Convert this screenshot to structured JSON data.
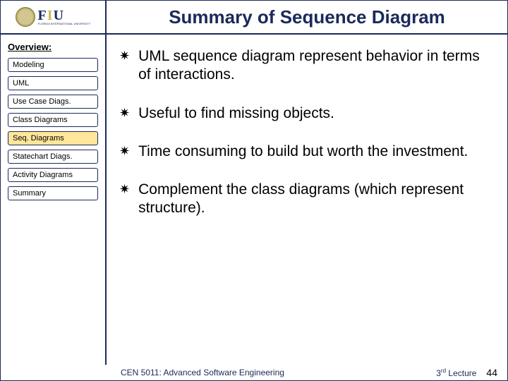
{
  "header": {
    "logo_main": "FIU",
    "logo_sub": "FLORIDA INTERNATIONAL UNIVERSITY",
    "title": "Summary of Sequence Diagram"
  },
  "sidebar": {
    "heading": "Overview:",
    "items": [
      {
        "label": "Modeling",
        "active": false
      },
      {
        "label": "UML",
        "active": false
      },
      {
        "label": "Use Case Diags.",
        "active": false
      },
      {
        "label": "Class Diagrams",
        "active": false
      },
      {
        "label": "Seq. Diagrams",
        "active": true
      },
      {
        "label": "Statechart Diags.",
        "active": false
      },
      {
        "label": "Activity Diagrams",
        "active": false
      },
      {
        "label": "Summary",
        "active": false
      }
    ]
  },
  "content": {
    "bullets": [
      "UML sequence diagram represent behavior in terms of interactions.",
      "Useful to find missing objects.",
      "Time consuming to build but worth the investment.",
      "Complement the class diagrams (which represent structure)."
    ]
  },
  "footer": {
    "course": "CEN 5011: Advanced Software Engineering",
    "lecture_num": "3",
    "lecture_suffix": "rd",
    "lecture_word": "Lecture",
    "page": "44"
  }
}
